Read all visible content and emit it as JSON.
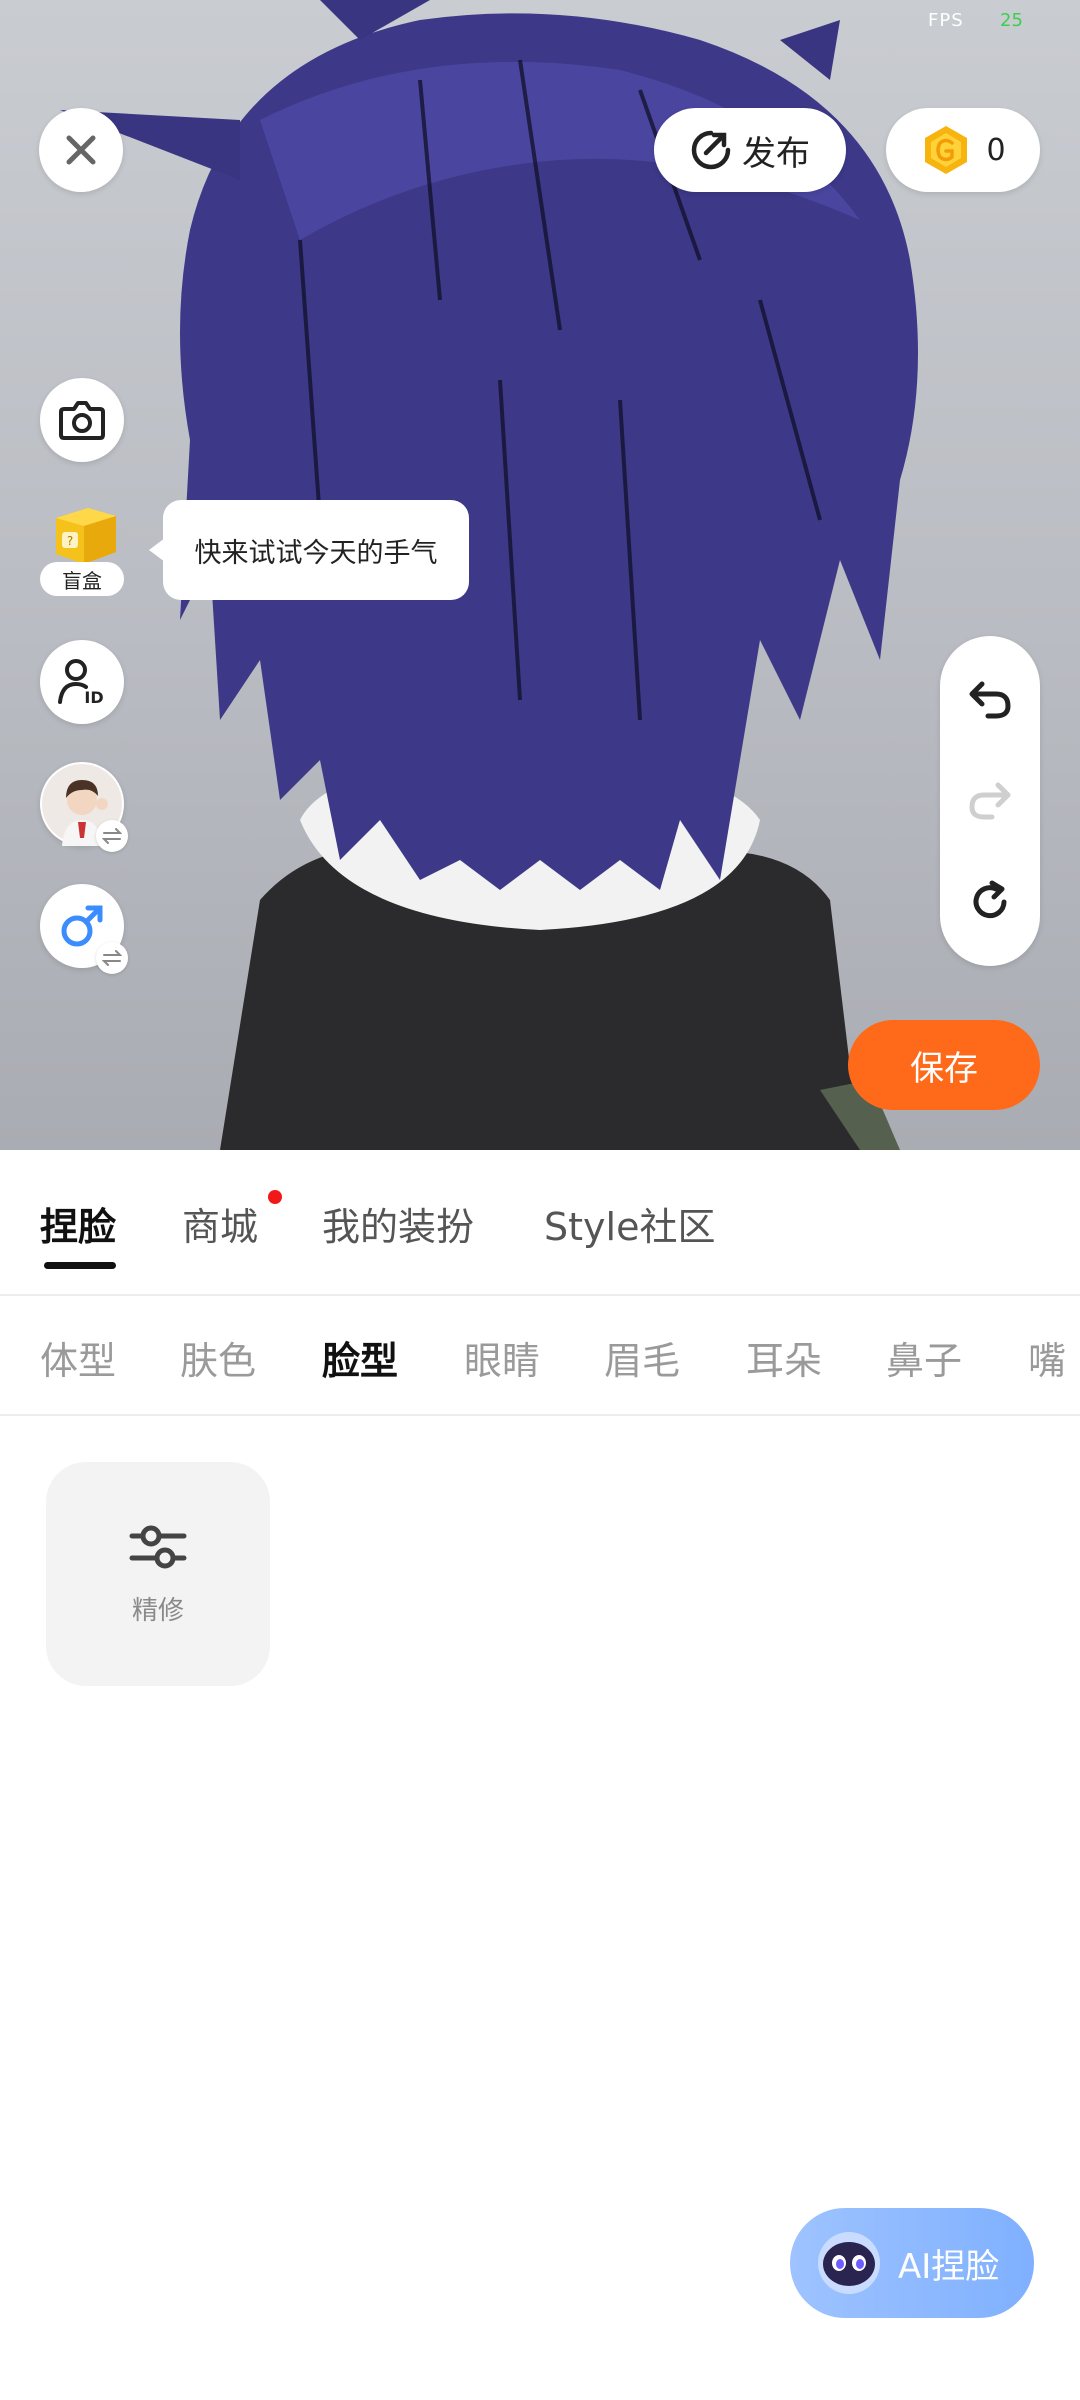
{
  "status": {
    "fps_label": "FPS",
    "fps_value": "25"
  },
  "top_bar": {
    "close_icon": "close-icon",
    "publish_label": "发布",
    "coin_count": "0"
  },
  "left_tools": {
    "camera_icon": "camera-icon",
    "blindbox_label": "盲盒",
    "id_icon": "person-id-icon",
    "outfit_icon": "avatar-thumbnail",
    "gender_icon": "male-symbol-icon",
    "tooltip_text": "快来试试今天的手气"
  },
  "history": {
    "undo_icon": "undo-icon",
    "redo_icon": "redo-icon",
    "reset_icon": "reset-icon"
  },
  "save_label": "保存",
  "main_tabs": [
    {
      "label": "捏脸",
      "active": true
    },
    {
      "label": "商城",
      "has_dot": true
    },
    {
      "label": "我的装扮"
    },
    {
      "label": "Style社区"
    }
  ],
  "sub_tabs": [
    {
      "label": "体型"
    },
    {
      "label": "肤色"
    },
    {
      "label": "脸型",
      "active": true
    },
    {
      "label": "眼睛"
    },
    {
      "label": "眉毛"
    },
    {
      "label": "耳朵"
    },
    {
      "label": "鼻子"
    },
    {
      "label": "嘴"
    }
  ],
  "tool_card": {
    "label": "精修",
    "icon": "sliders-icon"
  },
  "ai_button": {
    "label": "AI捏脸",
    "icon": "robot-icon"
  },
  "colors": {
    "accent_orange": "#ff6a1a",
    "ai_blue": "#8ab8ff",
    "hair": "#3a3580"
  }
}
